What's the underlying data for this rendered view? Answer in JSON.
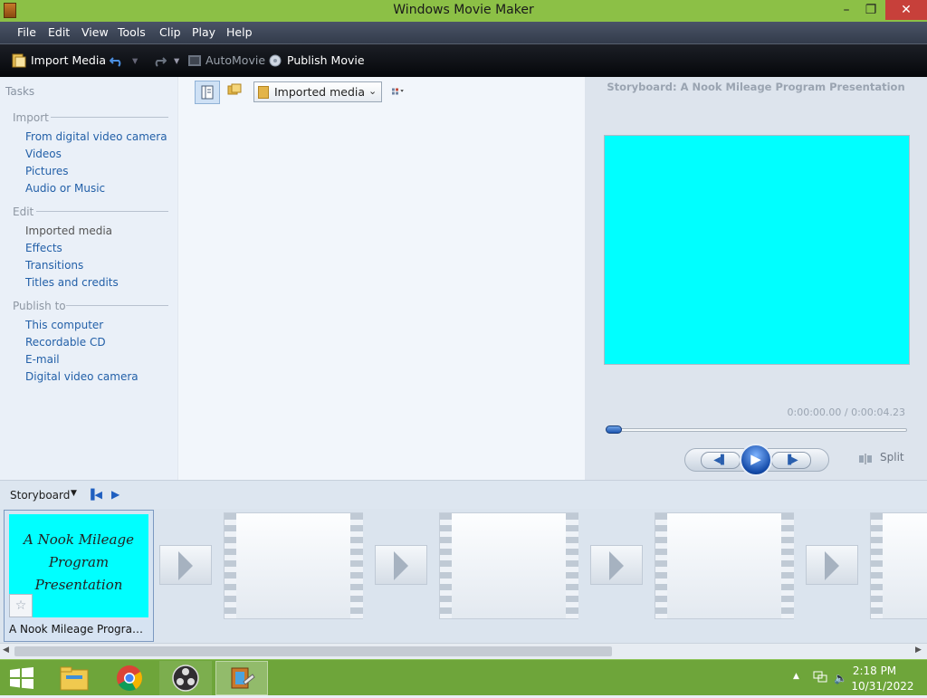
{
  "window": {
    "title": "Windows Movie Maker",
    "controls": {
      "minimize": "–",
      "restore": "❐",
      "close": "✕"
    }
  },
  "menu": [
    "File",
    "Edit",
    "View",
    "Tools",
    "Clip",
    "Play",
    "Help"
  ],
  "toolbar": {
    "import_media": "Import Media",
    "automovie": "AutoMovie",
    "publish_movie": "Publish Movie"
  },
  "tasks": {
    "title": "Tasks",
    "groups": [
      {
        "label": "Import",
        "items": [
          "From digital video camera",
          "Videos",
          "Pictures",
          "Audio or Music"
        ]
      },
      {
        "label": "Edit",
        "items": [
          "Imported media",
          "Effects",
          "Transitions",
          "Titles and credits"
        ]
      },
      {
        "label": "Publish to",
        "items": [
          "This computer",
          "Recordable CD",
          "E-mail",
          "Digital video camera"
        ]
      }
    ]
  },
  "collection": {
    "selected": "Imported media"
  },
  "preview": {
    "title": "Storyboard: A Nook Mileage Program Presentation",
    "monitor_color": "#00ffff",
    "timecode": "0:00:00.00 / 0:00:04.23",
    "progress": 0,
    "split_label": "Split"
  },
  "storyboard": {
    "view_label": "Storyboard",
    "clip": {
      "title_line1": "A Nook Mileage",
      "title_line2": "Program",
      "title_line3": "Presentation",
      "name": "A Nook Mileage Program Presentation"
    }
  },
  "taskbar": {
    "apps": [
      "file-explorer",
      "chrome",
      "obs-studio",
      "windows-movie-maker"
    ],
    "time": "2:18 PM",
    "date": "10/31/2022"
  },
  "colors": {
    "titlebar": "#8cc046",
    "taskbar": "#6ea53a",
    "accent": "#00ffff",
    "link": "#2360a8"
  }
}
